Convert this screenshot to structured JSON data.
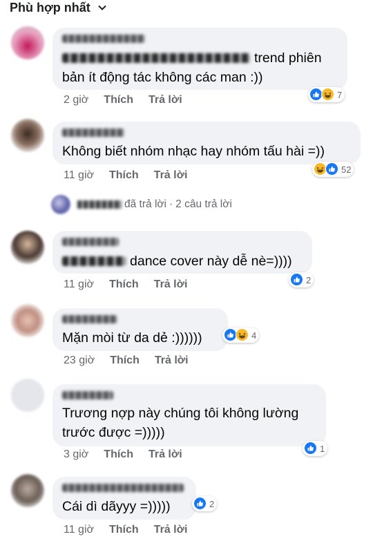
{
  "sort": {
    "label": "Phù hợp nhất"
  },
  "comments": [
    {
      "text": "trend phiên bản ít động tác không các man :))",
      "time": "2 giờ",
      "like": "Thích",
      "reply": "Trả lời",
      "reaction_count": "7"
    },
    {
      "text": "Không biết nhóm nhạc hay nhóm tấu hài =))",
      "time": "11 giờ",
      "like": "Thích",
      "reply": "Trả lời",
      "reaction_count": "52"
    },
    {
      "text": "dance cover này dễ nè=))))",
      "time": "11 giờ",
      "like": "Thích",
      "reply": "Trả lời",
      "reaction_count": "2"
    },
    {
      "text": "Mặn mòi từ da dẻ :))))))",
      "time": "23 giờ",
      "like": "Thích",
      "reply": "Trả lời",
      "reaction_count": "4"
    },
    {
      "text": "Trương nợp này chúng tôi không lường trước được =)))))",
      "time": "3 giờ",
      "like": "Thích",
      "reply": "Trả lời",
      "reaction_count": "1"
    },
    {
      "text": "Cái dì dãyyy =)))))",
      "time": "11 giờ",
      "like": "Thích",
      "reply": "Trả lời",
      "reaction_count": "2"
    }
  ],
  "replies_row": {
    "replied_label": "đã trả lời",
    "separator": "·",
    "count_label": "2 câu trả lời"
  },
  "colors": {
    "like_blue": "#1877f2",
    "haha_yellow": "#f7b928",
    "bubble_bg": "#f0f2f5",
    "meta_gray": "#65676b"
  },
  "icons": [
    "chevron-down-icon",
    "like-reaction-icon",
    "haha-reaction-icon"
  ]
}
